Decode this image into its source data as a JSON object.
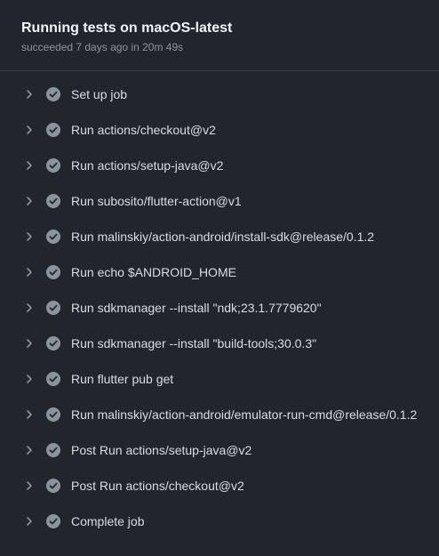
{
  "job": {
    "title": "Running tests on macOS-latest",
    "status": "succeeded 7 days ago in 20m 49s"
  },
  "steps": [
    {
      "name": "Set up job",
      "status": "success"
    },
    {
      "name": "Run actions/checkout@v2",
      "status": "success"
    },
    {
      "name": "Run actions/setup-java@v2",
      "status": "success"
    },
    {
      "name": "Run subosito/flutter-action@v1",
      "status": "success"
    },
    {
      "name": "Run malinskiy/action-android/install-sdk@release/0.1.2",
      "status": "success"
    },
    {
      "name": "Run echo $ANDROID_HOME",
      "status": "success"
    },
    {
      "name": "Run sdkmanager --install \"ndk;23.1.7779620\"",
      "status": "success"
    },
    {
      "name": "Run sdkmanager --install \"build-tools;30.0.3\"",
      "status": "success"
    },
    {
      "name": "Run flutter pub get",
      "status": "success"
    },
    {
      "name": "Run malinskiy/action-android/emulator-run-cmd@release/0.1.2",
      "status": "success"
    },
    {
      "name": "Post Run actions/setup-java@v2",
      "status": "success"
    },
    {
      "name": "Post Run actions/checkout@v2",
      "status": "success"
    },
    {
      "name": "Complete job",
      "status": "success"
    }
  ],
  "icons": {
    "expand": "chevron-right-icon",
    "success": "check-circle-icon"
  },
  "colors": {
    "background": "#22262c",
    "success_icon_fill": "#8b949e"
  }
}
